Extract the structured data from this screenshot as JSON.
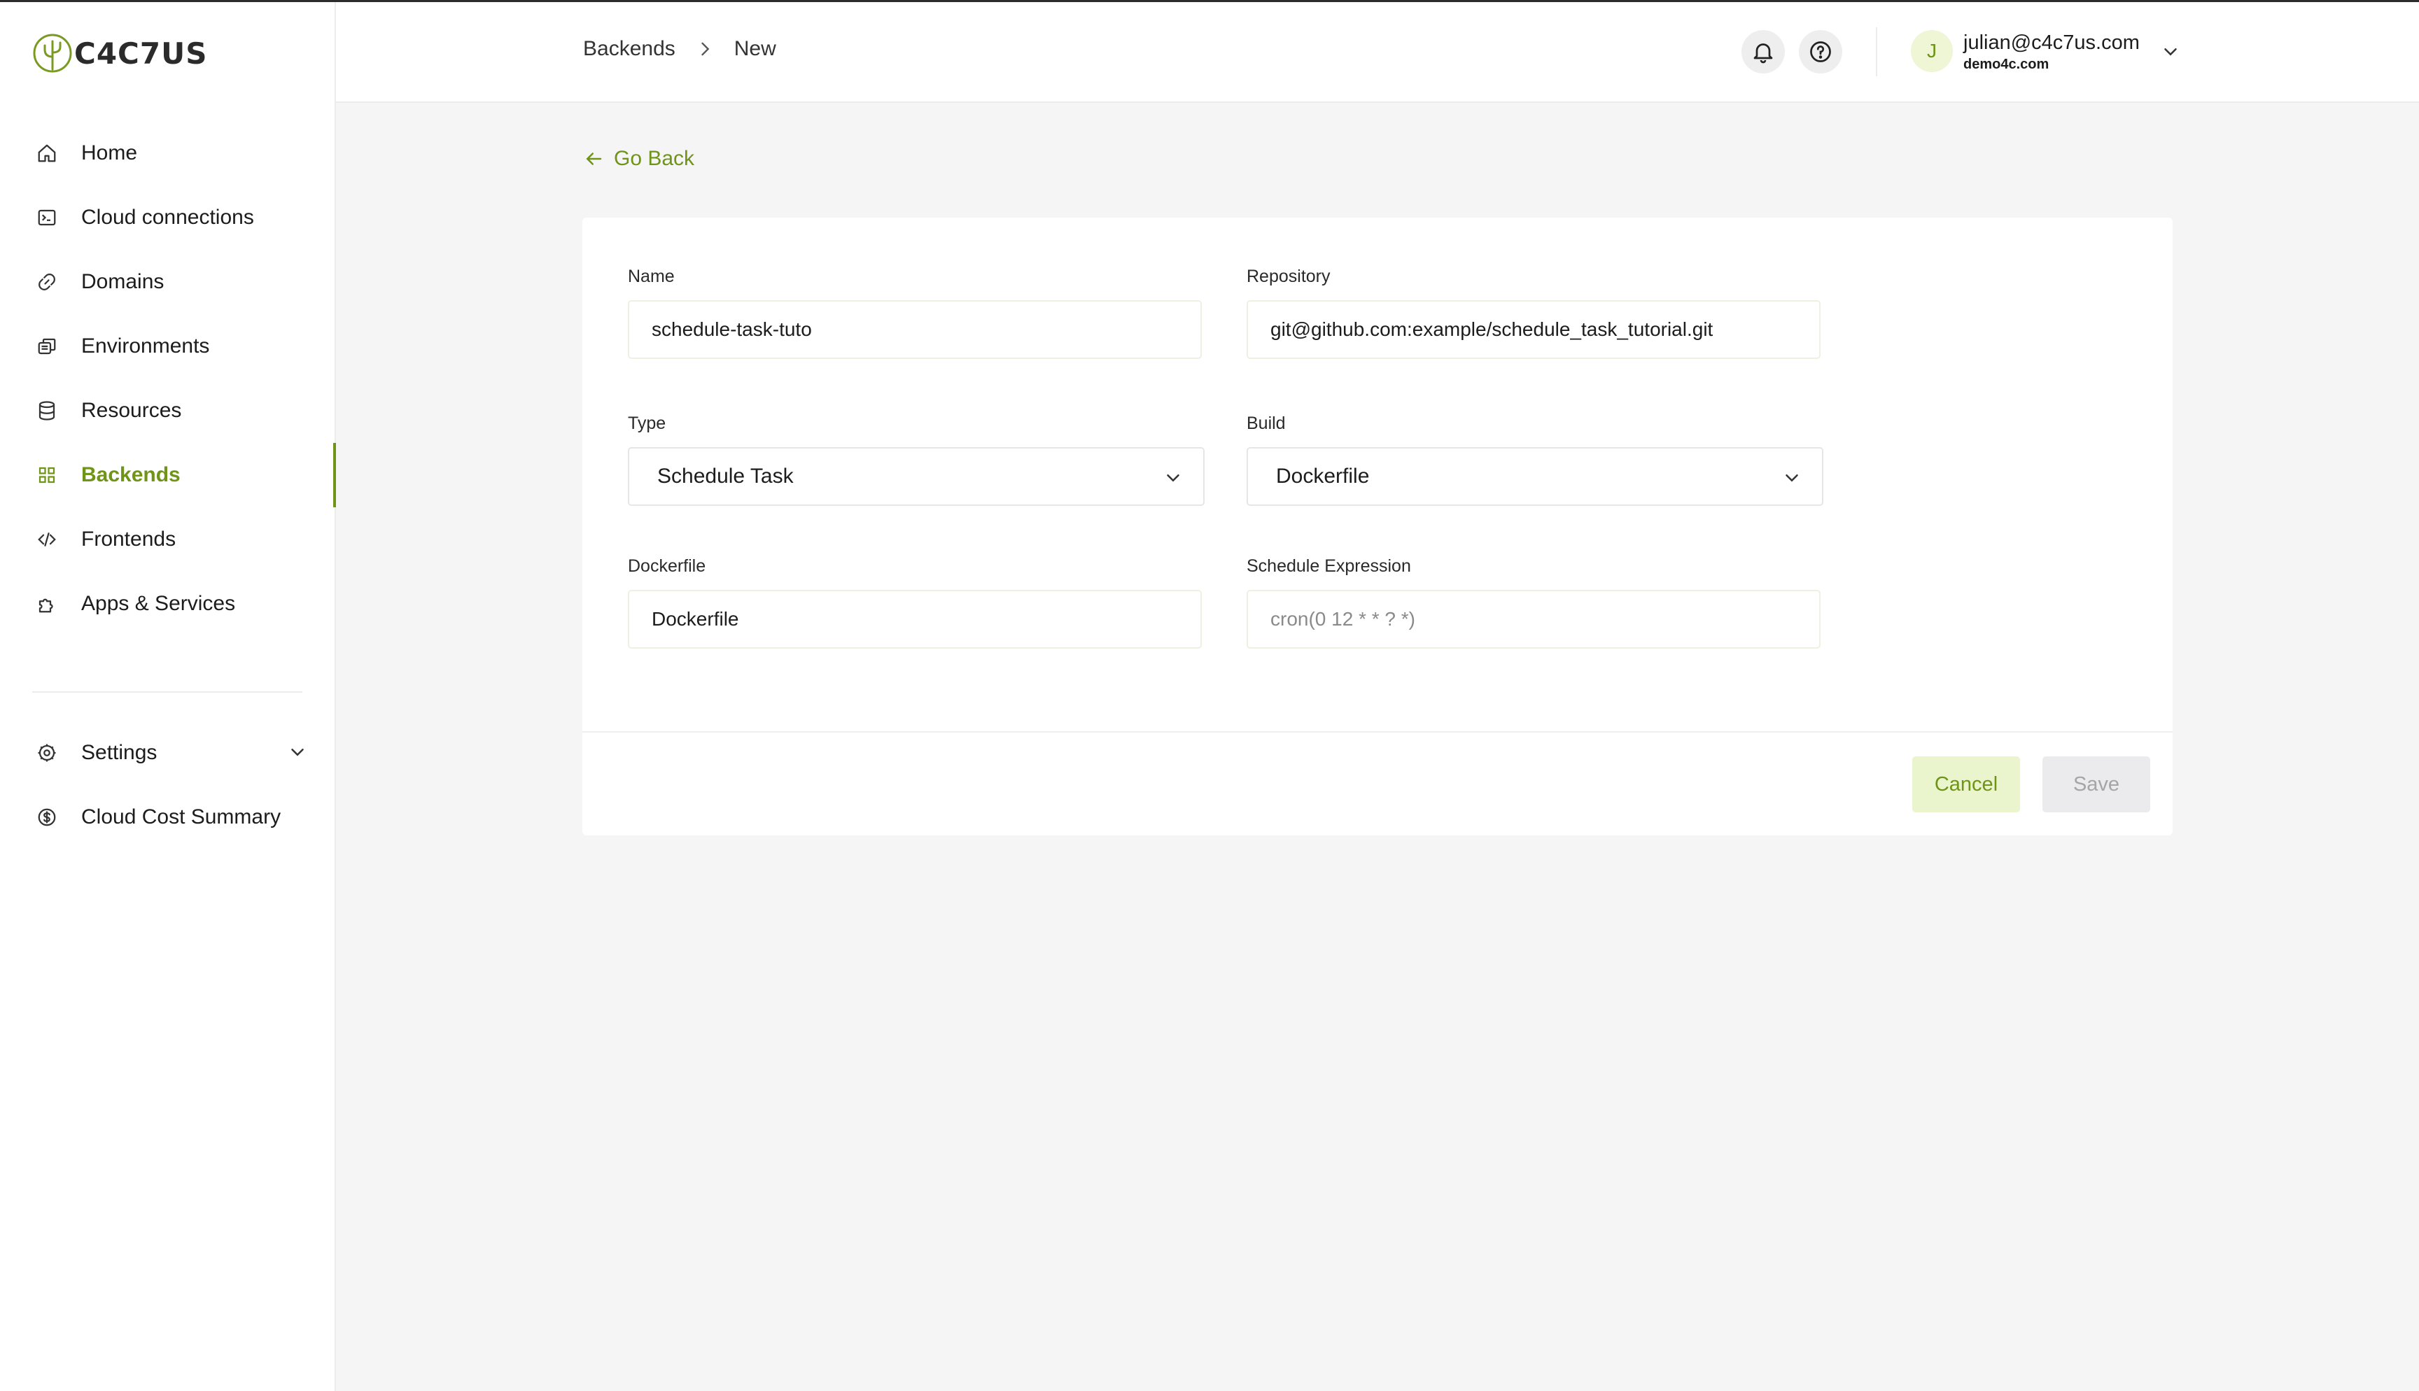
{
  "brand": {
    "name_part1": "C4C7",
    "name_part2": "US",
    "accent_color": "#6f9417"
  },
  "sidebar": {
    "items": [
      {
        "label": "Home",
        "icon": "home-icon"
      },
      {
        "label": "Cloud connections",
        "icon": "terminal-icon"
      },
      {
        "label": "Domains",
        "icon": "link-icon"
      },
      {
        "label": "Environments",
        "icon": "environments-icon"
      },
      {
        "label": "Resources",
        "icon": "database-icon"
      },
      {
        "label": "Backends",
        "icon": "grid-icon",
        "active": true
      },
      {
        "label": "Frontends",
        "icon": "code-icon"
      },
      {
        "label": "Apps & Services",
        "icon": "puzzle-icon"
      }
    ],
    "secondary": [
      {
        "label": "Settings",
        "icon": "gear-icon"
      },
      {
        "label": "Cloud Cost Summary",
        "icon": "dollar-circle-icon"
      }
    ]
  },
  "header": {
    "breadcrumb": {
      "parent": "Backends",
      "current": "New"
    },
    "user": {
      "initial": "J",
      "email": "julian@c4c7us.com",
      "org": "demo4c.com"
    }
  },
  "main": {
    "go_back": "Go Back",
    "form": {
      "name": {
        "label": "Name",
        "value": "schedule-task-tuto"
      },
      "repository": {
        "label": "Repository",
        "value": "git@github.com:example/schedule_task_tutorial.git"
      },
      "type": {
        "label": "Type",
        "selected": "Schedule Task"
      },
      "build": {
        "label": "Build",
        "selected": "Dockerfile"
      },
      "dockerfile": {
        "label": "Dockerfile",
        "value": "Dockerfile"
      },
      "schedule": {
        "label": "Schedule Expression",
        "value": "",
        "placeholder": "cron(0 12 * * ? *)"
      }
    },
    "actions": {
      "cancel": "Cancel",
      "save": "Save"
    }
  }
}
